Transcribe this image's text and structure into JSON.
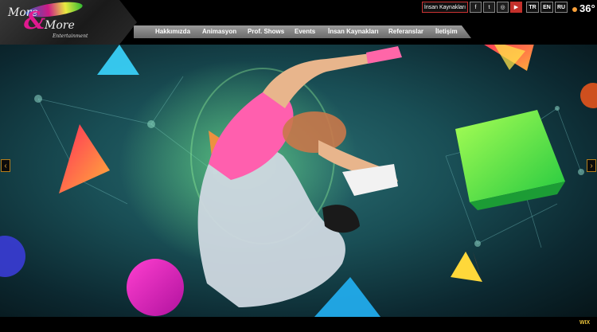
{
  "logo": {
    "line1": "More",
    "amp": "&",
    "line2": "More",
    "line3": "Entertainment"
  },
  "topbar": {
    "link": "İnsan Kaynakları",
    "social": [
      {
        "icon": "facebook-icon",
        "glyph": "f"
      },
      {
        "icon": "twitter-icon",
        "glyph": "t"
      },
      {
        "icon": "instagram-icon",
        "glyph": "◎"
      },
      {
        "icon": "youtube-icon",
        "glyph": "▶"
      }
    ],
    "languages": [
      "TR",
      "EN",
      "RU"
    ],
    "weather": {
      "temp": "36°",
      "icon": "sun-icon"
    }
  },
  "nav": {
    "items": [
      "Hakkımızda",
      "Animasyon",
      "Prof. Shows",
      "Events",
      "İnsan Kaynakları",
      "Referanslar",
      "İletişim"
    ]
  },
  "slider": {
    "prev_glyph": "‹",
    "next_glyph": "›"
  },
  "footer": {
    "badge": "WIX"
  },
  "colors": {
    "accent": "#e0198f",
    "nav_bg": "#8a8a8a",
    "arrow_border": "#b57d1c"
  }
}
